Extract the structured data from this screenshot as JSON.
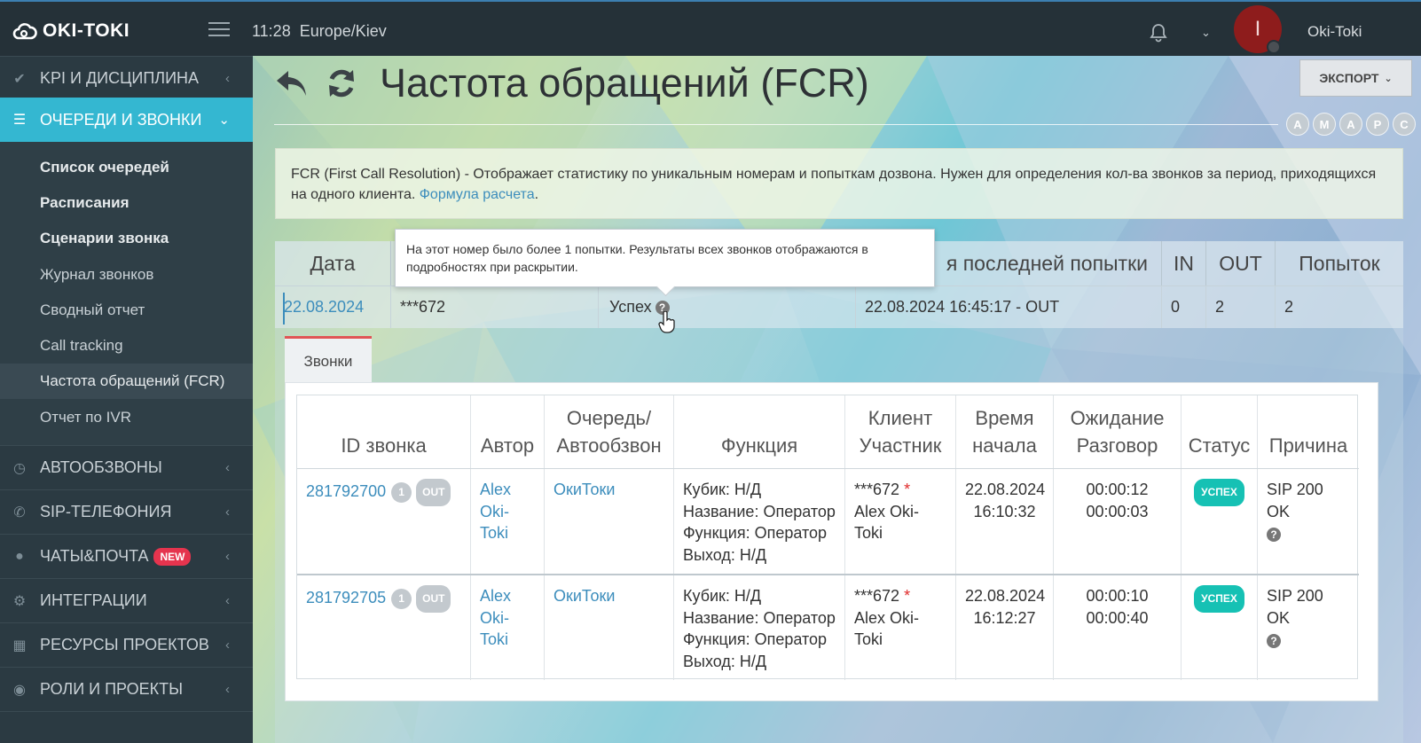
{
  "topbar": {
    "logo_text": "OKI-TOKI",
    "time": "11:28",
    "timezone": "Europe/Kiev",
    "avatar_letter": "I",
    "username": "Oki-Toki"
  },
  "sidebar": {
    "items": [
      {
        "label": "KPI И ДИСЦИПЛИНА",
        "icon": "check-icon"
      },
      {
        "label": "ОЧЕРЕДИ И ЗВОНКИ",
        "icon": "list-icon"
      },
      {
        "label": "АВТООБЗВОНЫ",
        "icon": "clock-icon"
      },
      {
        "label": "SIP-ТЕЛЕФОНИЯ",
        "icon": "phone-icon"
      },
      {
        "label": "ЧАТЫ&ПОЧТА",
        "icon": "chat-icon",
        "badge": "NEW"
      },
      {
        "label": "ИНТЕГРАЦИИ",
        "icon": "gears-icon"
      },
      {
        "label": "РЕСУРСЫ ПРОЕКТОВ",
        "icon": "grid-icon"
      },
      {
        "label": "РОЛИ И ПРОЕКТЫ",
        "icon": "toggle-icon"
      }
    ],
    "subitems": [
      "Список очередей",
      "Расписания",
      "Сценарии звонка",
      "Журнал звонков",
      "Сводный отчет",
      "Call tracking",
      "Частота обращений (FCR)",
      "Отчет по IVR"
    ]
  },
  "page": {
    "title": "Частота обращений (FCR)",
    "export_label": "ЭКСПОРТ",
    "letters": [
      "A",
      "M",
      "A",
      "P",
      "C"
    ],
    "info_text": "FCR (First Call Resolution) - Отображает статистику по уникальным номерам и попыткам дозвона. Нужен для определения кол-ва звонков за период, приходящихся на одного клиента.",
    "info_link": "Формула расчета",
    "info_dot": "."
  },
  "fcr_table": {
    "headers": [
      "Дата",
      "",
      "",
      "я последней попытки",
      "IN",
      "OUT",
      "Попыток"
    ],
    "row": {
      "date": "22.08.2024",
      "number": "***672",
      "result": "Успех",
      "last_attempt": "22.08.2024 16:45:17 - OUT",
      "in": "0",
      "out": "2",
      "attempts": "2"
    },
    "tooltip": "На этот номер было более 1 попытки. Результаты всех звонков отображаются в подробностях при раскрытии."
  },
  "calls_tab": "Звонки",
  "calls": {
    "headers": {
      "id": "ID звонка",
      "author": "Автор",
      "queue_1": "Очередь/",
      "queue_2": "Автообзвон",
      "function": "Функция",
      "client_1": "Клиент",
      "client_2": "Участник",
      "time_1": "Время",
      "time_2": "начала",
      "wait_1": "Ожидание",
      "wait_2": "Разговор",
      "status": "Статус",
      "reason": "Причина"
    },
    "rows": [
      {
        "id": "281792700",
        "count": "1",
        "dir": "OUT",
        "author_1": "Alex",
        "author_2": "Oki-",
        "author_3": "Toki",
        "queue": "ОкиТоки",
        "fn_1": "Кубик: Н/Д",
        "fn_2": "Название: Оператор",
        "fn_3": "Функция: Оператор",
        "fn_4": "Выход: Н/Д",
        "client": "***672",
        "star": "*",
        "participant": "Alex Oki-Toki",
        "date": "22.08.2024",
        "time": "16:10:32",
        "wait": "00:00:12",
        "talk": "00:00:03",
        "status": "УСПЕХ",
        "reason": "SIP 200 OK"
      },
      {
        "id": "281792705",
        "count": "1",
        "dir": "OUT",
        "author_1": "Alex",
        "author_2": "Oki-",
        "author_3": "Toki",
        "queue": "ОкиТоки",
        "fn_1": "Кубик: Н/Д",
        "fn_2": "Название: Оператор",
        "fn_3": "Функция: Оператор",
        "fn_4": "Выход: Н/Д",
        "client": "***672",
        "star": "*",
        "participant": "Alex Oki-Toki",
        "date": "22.08.2024",
        "time": "16:12:27",
        "wait": "00:00:10",
        "talk": "00:00:40",
        "status": "УСПЕХ",
        "reason": "SIP 200 OK"
      }
    ]
  }
}
